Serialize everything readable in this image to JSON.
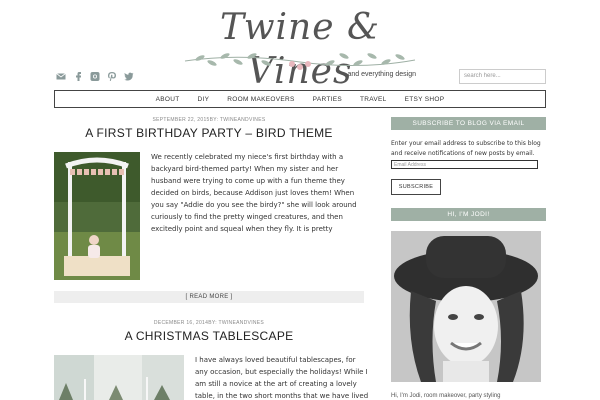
{
  "header": {
    "logo_title": "Twine & Vines",
    "tagline": "and everything design",
    "search_placeholder": "search here..."
  },
  "social_icons": [
    "mail-icon",
    "facebook-icon",
    "instagram-icon",
    "pinterest-icon",
    "twitter-icon"
  ],
  "nav": {
    "items": [
      "ABOUT",
      "DIY",
      "ROOM MAKEOVERS",
      "PARTIES",
      "TRAVEL",
      "ETSY SHOP"
    ]
  },
  "posts": [
    {
      "meta": "SEPTEMBER 22, 2015BY: TWINEANDVINES",
      "title": "A FIRST BIRTHDAY PARTY – BIRD THEME",
      "excerpt": "We recently celebrated my niece's first birthday with a backyard bird-themed party!  When my sister and her husband were trying to come up with a fun theme they decided on birds, because Addison just loves them!  When you say \"Addie do you see the birdy?\" she will look around curiously to find the pretty winged creatures, and then excitedly point and squeal when they fly.  It is pretty",
      "read_more": "[ READ MORE ]"
    },
    {
      "meta": "DECEMBER 16, 2014BY: TWINEANDVINES",
      "title": "A CHRISTMAS TABLESCAPE",
      "excerpt": "I have always loved beautiful tablescapes, for any occasion, but especially the holidays! While I am still a novice at the art of creating a lovely table, in the two short months that we have lived in our new"
    }
  ],
  "sidebar": {
    "subscribe_heading": "SUBSCRIBE TO BLOG VIA EMAIL",
    "subscribe_text": "Enter your email address to subscribe to this blog and receive notifications of new posts by email.",
    "email_placeholder": "Email Address",
    "subscribe_button": "SUBSCRIBE",
    "about_heading": "HI, I'M JODI!",
    "about_text": "Hi, I'm Jodi, room makeover, party styling"
  },
  "colors": {
    "sidebar_heading_bg": "#9fb0a5",
    "readmore_bg": "#eeeeee",
    "social_icon": "#8a9a9a"
  }
}
